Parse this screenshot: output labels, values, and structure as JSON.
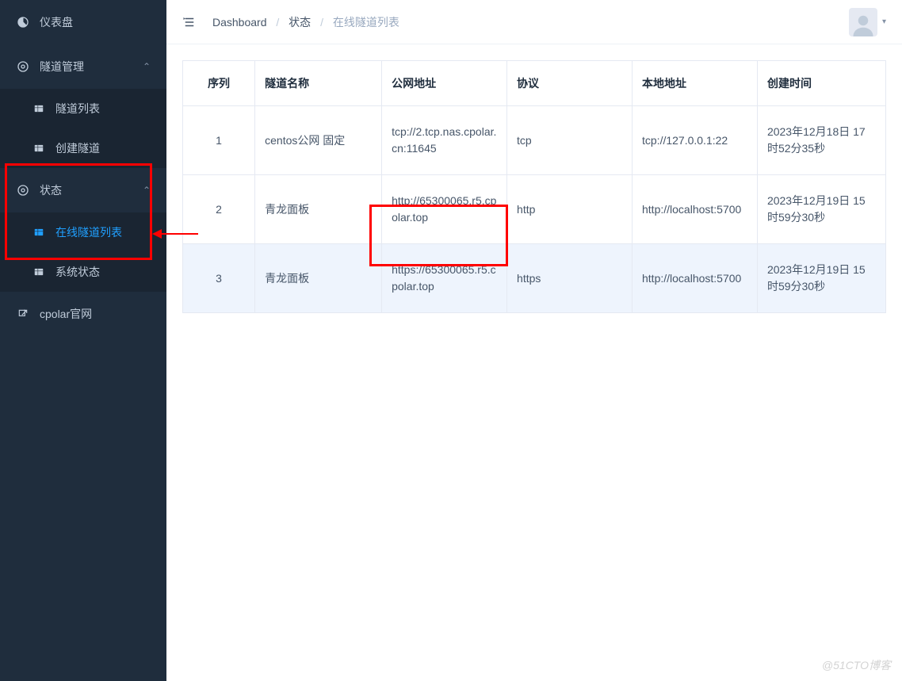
{
  "sidebar": {
    "items": [
      {
        "icon": "dashboard-icon",
        "label": "仪表盘"
      },
      {
        "icon": "tunnel-icon",
        "label": "隧道管理",
        "chevron": true
      },
      {
        "icon": "table-icon",
        "label": "隧道列表",
        "sub": true
      },
      {
        "icon": "table-icon",
        "label": "创建隧道",
        "sub": true
      },
      {
        "icon": "status-icon",
        "label": "状态",
        "chevron": true
      },
      {
        "icon": "table-icon",
        "label": "在线隧道列表",
        "sub": true,
        "active": true
      },
      {
        "icon": "table-icon",
        "label": "系统状态",
        "sub": true
      },
      {
        "icon": "external-icon",
        "label": "cpolar官网"
      }
    ]
  },
  "breadcrumb": {
    "items": [
      "Dashboard",
      "状态",
      "在线隧道列表"
    ]
  },
  "table": {
    "headers": [
      "序列",
      "隧道名称",
      "公网地址",
      "协议",
      "本地地址",
      "创建时间"
    ],
    "rows": [
      {
        "seq": "1",
        "name": "centos公网 固定",
        "url": "tcp://2.tcp.nas.cpolar.cn:11645",
        "proto": "tcp",
        "local": "tcp://127.0.0.1:22",
        "time": "2023年12月18日 17时52分35秒"
      },
      {
        "seq": "2",
        "name": "青龙面板",
        "url": "http://65300065.r5.cpolar.top",
        "proto": "http",
        "local": "http://localhost:5700",
        "time": "2023年12月19日 15时59分30秒"
      },
      {
        "seq": "3",
        "name": "青龙面板",
        "url": "https://65300065.r5.cpolar.top",
        "proto": "https",
        "local": "http://localhost:5700",
        "time": "2023年12月19日 15时59分30秒",
        "highlighted": true
      }
    ]
  },
  "watermark": "@51CTO博客"
}
